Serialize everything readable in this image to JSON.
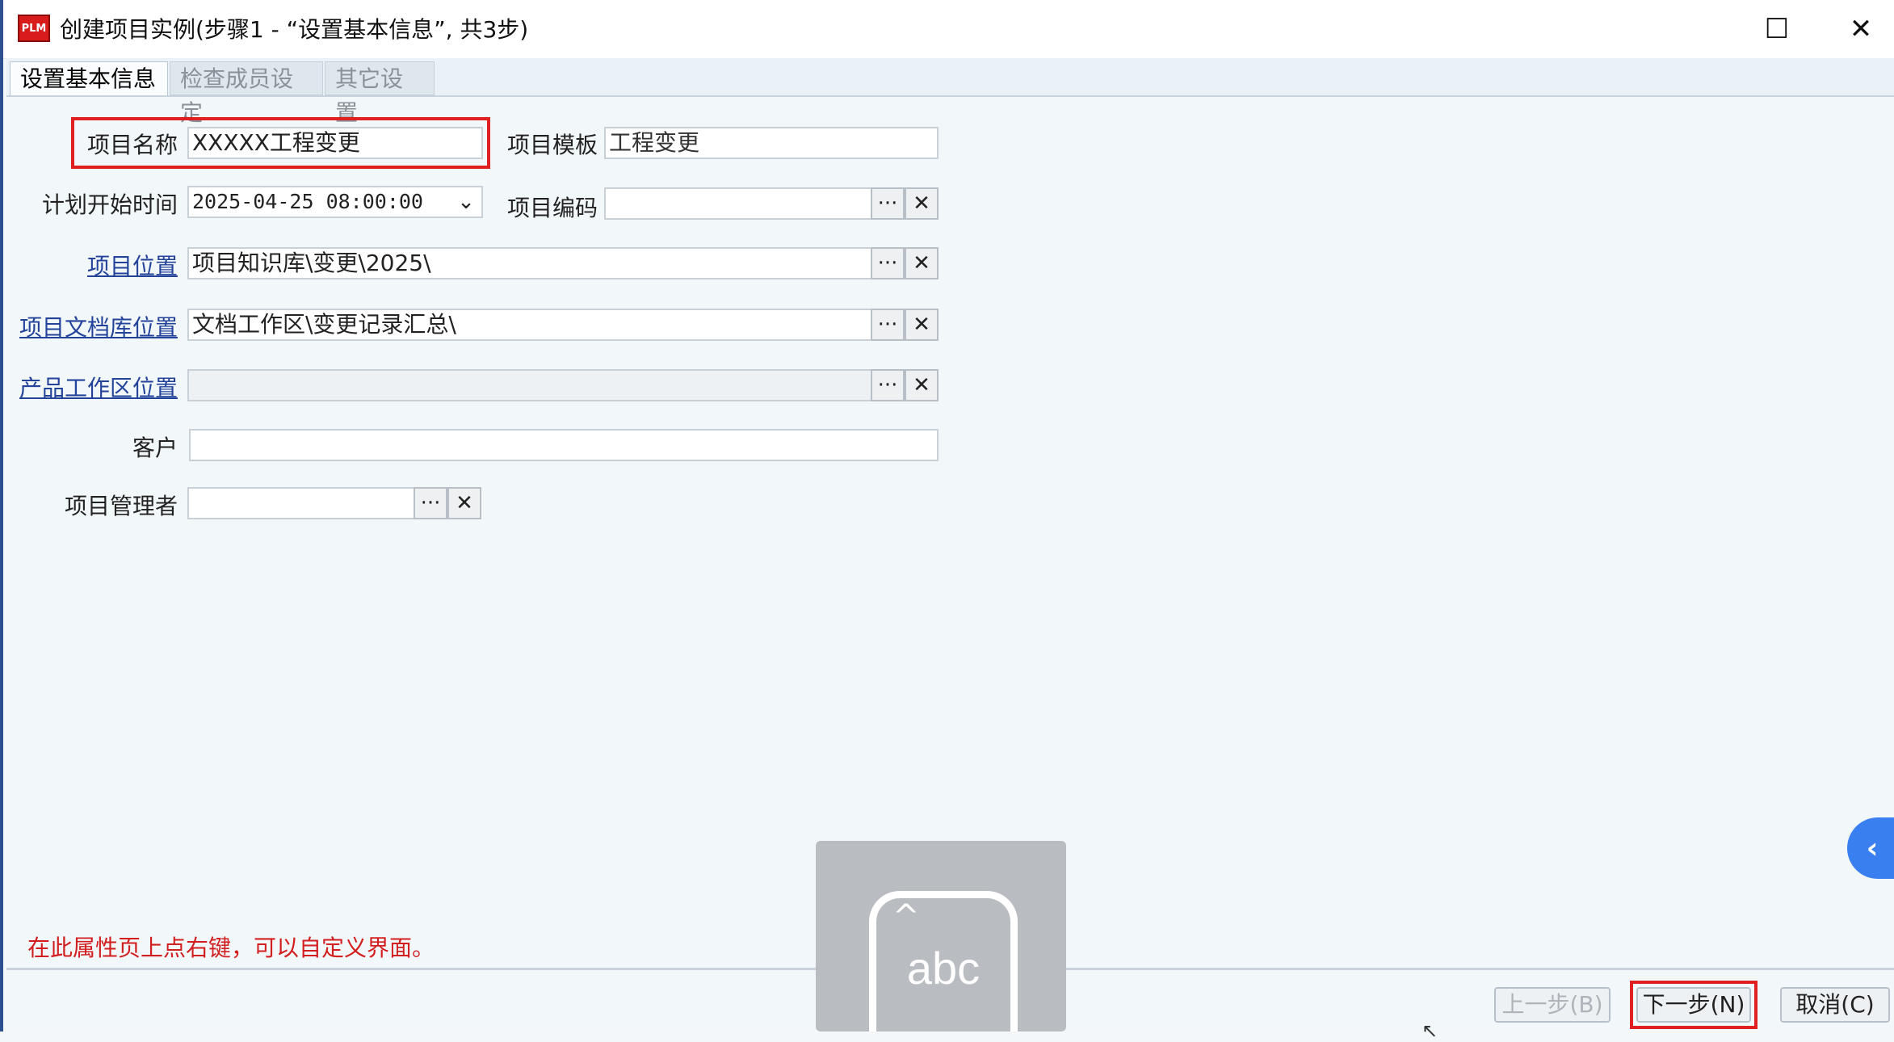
{
  "window": {
    "app_icon_label": "PLM",
    "title": "创建项目实例(步骤1 - “设置基本信息”, 共3步)",
    "maximize_symbol": "☐",
    "close_symbol": "✕"
  },
  "tabs": [
    {
      "label": "设置基本信息",
      "active": true
    },
    {
      "label": "检查成员设定",
      "active": false
    },
    {
      "label": "其它设置",
      "active": false
    }
  ],
  "form": {
    "project_name_label": "项目名称",
    "project_name_value": "XXXXX工程变更",
    "template_label": "项目模板",
    "template_value": "工程变更",
    "start_time_label": "计划开始时间",
    "start_time_value": "2025-04-25 08:00:00",
    "project_code_label": "项目编码",
    "project_code_value": "",
    "location_label": "项目位置",
    "location_value": "项目知识库\\变更\\2025\\",
    "doc_location_label": "项目文档库位置",
    "doc_location_value": "文档工作区\\变更记录汇总\\",
    "product_location_label": "产品工作区位置",
    "product_location_value": "",
    "customer_label": "客户",
    "customer_value": "",
    "manager_label": "项目管理者",
    "manager_value": "",
    "browse_symbol": "···",
    "clear_symbol": "✕",
    "dropdown_symbol": "⌄"
  },
  "hint": "在此属性页上点右键，可以自定义界面。",
  "buttons": {
    "prev": "上一步(B)",
    "next": "下一步(N)",
    "cancel": "取消(C)"
  },
  "ime": {
    "label": "abc",
    "caret": "^"
  },
  "side_tab_symbol": "‹",
  "colors": {
    "highlight": "#e02020",
    "link": "#23439a",
    "hint": "#d21e1e",
    "app_icon": "#d81b1b"
  }
}
